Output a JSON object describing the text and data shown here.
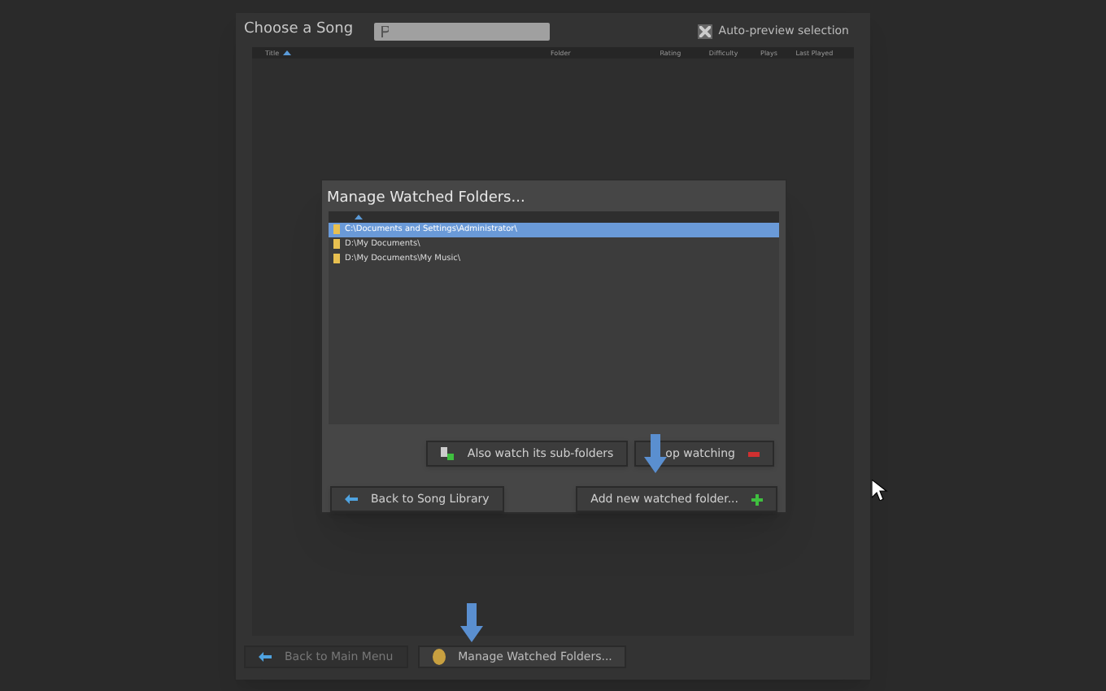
{
  "header": {
    "title": "Choose a Song",
    "auto_preview": {
      "label": "Auto-preview selection",
      "checked": true
    }
  },
  "song_table": {
    "columns": [
      {
        "label": "Title",
        "sorted": true
      },
      {
        "label": "Folder",
        "sorted": false
      },
      {
        "label": "Rating",
        "sorted": false
      },
      {
        "label": "Difficulty",
        "sorted": false
      },
      {
        "label": "Plays",
        "sorted": false
      },
      {
        "label": "Last Played",
        "sorted": false
      }
    ]
  },
  "dialog": {
    "title": "Manage Watched Folders...",
    "folders": [
      {
        "path": "C:\\Documents and Settings\\Administrator\\",
        "selected": true
      },
      {
        "path": "D:\\My Documents\\",
        "selected": false
      },
      {
        "path": "D:\\My Documents\\My Music\\",
        "selected": false
      }
    ],
    "buttons": [
      {
        "label": "Also watch its sub-folders",
        "kind": "subfolders"
      },
      {
        "label": "op watching",
        "kind": "remove"
      },
      {
        "label": "Back to Song Library",
        "kind": "back"
      },
      {
        "label": "Add new watched folder...",
        "kind": "add"
      }
    ]
  },
  "footer": {
    "buttons": [
      {
        "label": "Back to Main Menu",
        "kind": "back",
        "disabled": true
      },
      {
        "label": "Manage Watched Folders...",
        "kind": "folders",
        "disabled": false
      }
    ]
  }
}
